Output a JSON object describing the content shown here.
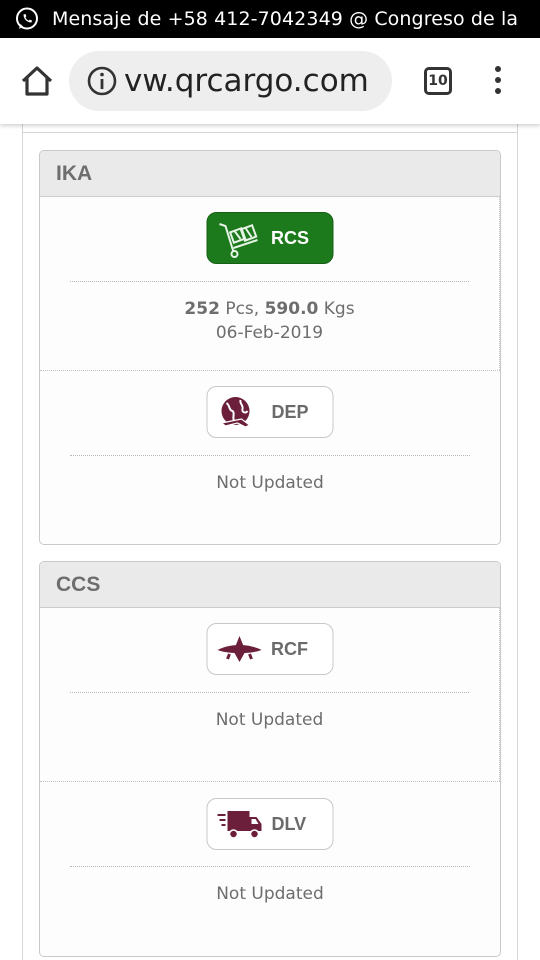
{
  "status_bar": {
    "notification_icon": "whatsapp-icon",
    "notification_text": "Mensaje de +58 412-7042349 @ Congreso de la"
  },
  "browser": {
    "url": "vw.qrcargo.com",
    "tab_count": "10"
  },
  "stations": [
    {
      "code": "IKA",
      "events": [
        {
          "code": "RCS",
          "icon": "cart-with-boxes-icon",
          "status": "active",
          "color": "#1c7a1c",
          "pcs_value": "252",
          "pcs_unit": "Pcs,",
          "weight_value": "590.0",
          "weight_unit": "Kgs",
          "date": "06-Feb-2019"
        },
        {
          "code": "DEP",
          "icon": "globe-plane-icon",
          "status": "inactive",
          "color": "#6b1f3a",
          "note": "Not Updated"
        }
      ]
    },
    {
      "code": "CCS",
      "events": [
        {
          "code": "RCF",
          "icon": "airplane-icon",
          "status": "inactive",
          "color": "#6b1f3a",
          "note": "Not Updated"
        },
        {
          "code": "DLV",
          "icon": "delivery-truck-icon",
          "status": "inactive",
          "color": "#6b1f3a",
          "note": "Not Updated"
        }
      ]
    }
  ]
}
